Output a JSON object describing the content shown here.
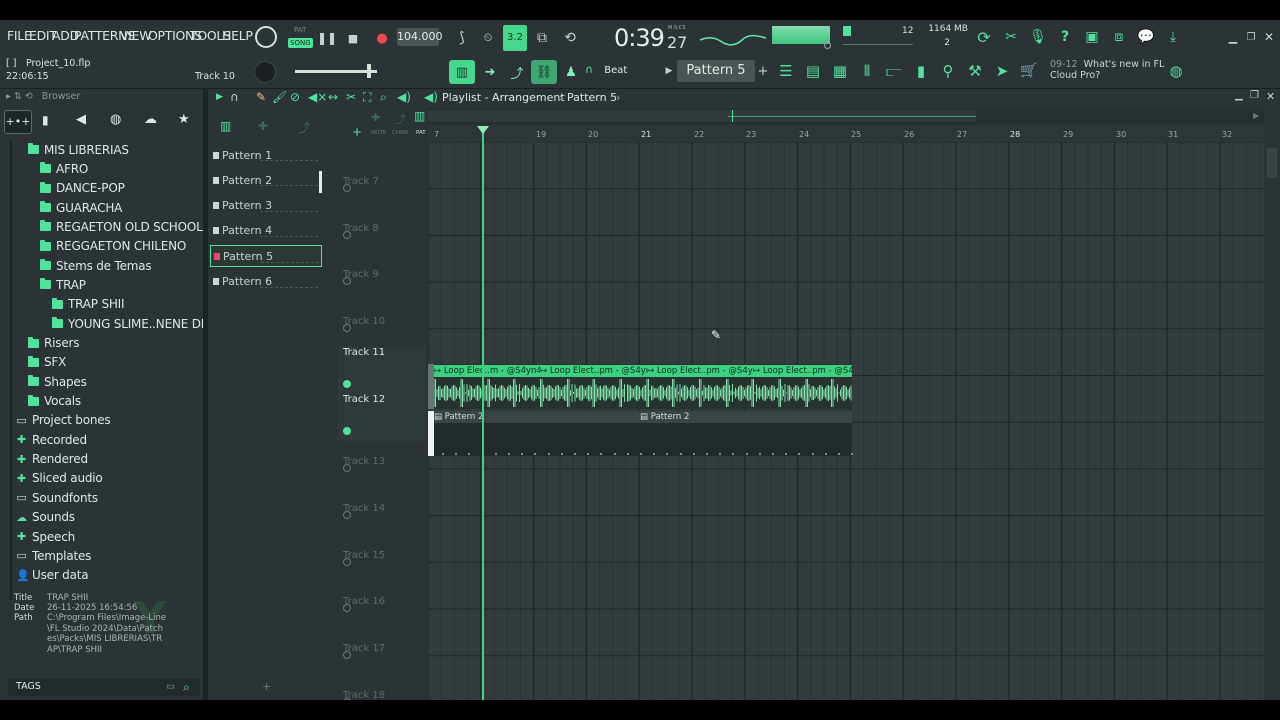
{
  "menu": [
    "FILE",
    "EDIT",
    "ADD",
    "PATTERNS",
    "VIEW",
    "OPTIONS",
    "TOOLS",
    "HELP"
  ],
  "transport": {
    "pat_label": "PAT",
    "song_label": "SONG",
    "tempo": "104.000",
    "time_main": "0:39",
    "time_sub": "27",
    "time_unit": "M:S:CS",
    "cpu": "12",
    "mem": "1164 MB",
    "voices": "2",
    "snap": "3.2"
  },
  "project": {
    "file": "Project_10.flp",
    "time": "22:06:15",
    "track_hint": "Track 10"
  },
  "toolbar2": {
    "snap_label": "Beat",
    "pattern_selector": "Pattern 5"
  },
  "news": {
    "date": "09-12",
    "text1": "What's new in FL",
    "text2": "Cloud Pro?"
  },
  "browser": {
    "title": "Browser",
    "items": [
      {
        "label": "MIS LIBRERIAS",
        "type": "folder",
        "indent": 1
      },
      {
        "label": "AFRO",
        "type": "folder",
        "indent": 2
      },
      {
        "label": "DANCE-POP",
        "type": "folder",
        "indent": 2
      },
      {
        "label": "GUARACHA",
        "type": "folder",
        "indent": 2
      },
      {
        "label": "REGAETON OLD SCHOOL",
        "type": "folder",
        "indent": 2
      },
      {
        "label": "REGGAETON CHILENO",
        "type": "folder",
        "indent": 2
      },
      {
        "label": "Stems de Temas",
        "type": "folder",
        "indent": 2
      },
      {
        "label": "TRAP",
        "type": "folder",
        "indent": 2
      },
      {
        "label": "TRAP SHII",
        "type": "folder",
        "indent": 3
      },
      {
        "label": "YOUNG SLIME..NENE DE ORO",
        "type": "folder",
        "indent": 3
      },
      {
        "label": "Risers",
        "type": "folder",
        "indent": 1
      },
      {
        "label": "SFX",
        "type": "folder",
        "indent": 1
      },
      {
        "label": "Shapes",
        "type": "folder",
        "indent": 1
      },
      {
        "label": "Vocals",
        "type": "folder",
        "indent": 1
      },
      {
        "label": "Project bones",
        "type": "outline",
        "indent": 0
      },
      {
        "label": "Recorded",
        "type": "plus",
        "indent": 0
      },
      {
        "label": "Rendered",
        "type": "plus",
        "indent": 0
      },
      {
        "label": "Sliced audio",
        "type": "plus",
        "indent": 0
      },
      {
        "label": "Soundfonts",
        "type": "outline",
        "indent": 0
      },
      {
        "label": "Sounds",
        "type": "cloud",
        "indent": 0
      },
      {
        "label": "Speech",
        "type": "plus",
        "indent": 0
      },
      {
        "label": "Templates",
        "type": "outline",
        "indent": 0
      },
      {
        "label": "User data",
        "type": "user",
        "indent": 0
      }
    ],
    "info": {
      "title_label": "Title",
      "title": "TRAP SHII",
      "date_label": "Date",
      "date": "26-11-2025 16:54:56",
      "path_label": "Path",
      "path": "C:\\Program Files\\Image-Line\\FL Studio 2024\\Data\\Patches\\Packs\\MIS LIBRERIAS\\TRAP\\TRAP SHII"
    },
    "tags_label": "TAGS"
  },
  "patterns": [
    "Pattern 1",
    "Pattern 2",
    "Pattern 3",
    "Pattern 4",
    "Pattern 5",
    "Pattern 6"
  ],
  "playlist": {
    "breadcrumb": "Playlist - Arrangement",
    "pattern": "Pattern 5",
    "ruler": [
      "7",
      "19",
      "20",
      "21",
      "22",
      "23",
      "24",
      "25",
      "26",
      "27",
      "28",
      "29",
      "30",
      "31",
      "32"
    ],
    "tracks": [
      "Track 7",
      "Track 8",
      "Track 9",
      "Track 10",
      "Track 11",
      "Track 12",
      "Track 13",
      "Track 14",
      "Track 15",
      "Track 16",
      "Track 17",
      "Track 18"
    ],
    "audio_clips": [
      "Loop Elec..m - @S4yn4",
      "Loop Elect..pm - @S4yn4",
      "Loop Elect..pm - @S4yn4",
      "Loop Elect..pm - @S4yn4"
    ],
    "pattern_clips": [
      "Pattern 2",
      "Pattern 2"
    ]
  },
  "colors": {
    "accent": "#4fe39b",
    "clip_head": "#3cd180",
    "bg": "#2b3337"
  }
}
